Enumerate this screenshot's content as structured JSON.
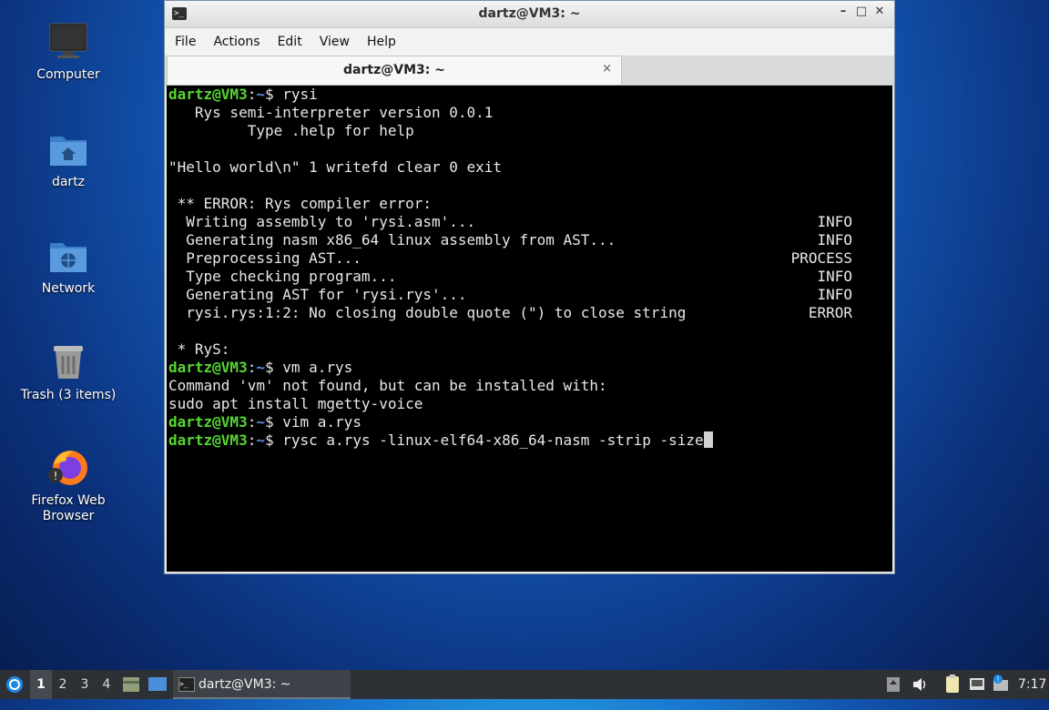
{
  "desktop": {
    "icons": [
      {
        "label": "Computer",
        "icon": "monitor-icon"
      },
      {
        "label": "dartz",
        "icon": "home-folder-icon"
      },
      {
        "label": "Network",
        "icon": "network-folder-icon"
      },
      {
        "label": "Trash (3 items)",
        "icon": "trash-icon"
      },
      {
        "label": "Firefox Web Browser",
        "icon": "firefox-icon"
      }
    ]
  },
  "window": {
    "title": "dartz@VM3: ~",
    "controls": {
      "minimize": "–",
      "maximize": "□",
      "close": "✕"
    },
    "menu": [
      "File",
      "Actions",
      "Edit",
      "View",
      "Help"
    ],
    "tab": {
      "title": "dartz@VM3: ~",
      "close": "×"
    }
  },
  "terminal": {
    "lines": [
      {
        "type": "prompt",
        "user": "dartz@VM3",
        "path": "~",
        "cmd": "rysi"
      },
      {
        "type": "text",
        "text": "   Rys semi-interpreter version 0.0.1"
      },
      {
        "type": "text",
        "text": "         Type .help for help"
      },
      {
        "type": "text",
        "text": ""
      },
      {
        "type": "text",
        "text": "\"Hello world\\n\" 1 writefd clear 0 exit"
      },
      {
        "type": "text",
        "text": ""
      },
      {
        "type": "text",
        "text": " ** ERROR: Rys compiler error:"
      },
      {
        "type": "status",
        "text": "  Writing assembly to 'rysi.asm'...",
        "status": "INFO"
      },
      {
        "type": "status",
        "text": "  Generating nasm x86_64 linux assembly from AST...",
        "status": "INFO"
      },
      {
        "type": "status",
        "text": "  Preprocessing AST...",
        "status": "PROCESS"
      },
      {
        "type": "status",
        "text": "  Type checking program...",
        "status": "INFO"
      },
      {
        "type": "status",
        "text": "  Generating AST for 'rysi.rys'...",
        "status": "INFO"
      },
      {
        "type": "status",
        "text": "  rysi.rys:1:2: No closing double quote (\") to close string",
        "status": "ERROR"
      },
      {
        "type": "text",
        "text": ""
      },
      {
        "type": "text",
        "text": " * RyS:"
      },
      {
        "type": "prompt",
        "user": "dartz@VM3",
        "path": "~",
        "cmd": "vm a.rys"
      },
      {
        "type": "text",
        "text": "Command 'vm' not found, but can be installed with:"
      },
      {
        "type": "text",
        "text": "sudo apt install mgetty-voice"
      },
      {
        "type": "prompt",
        "user": "dartz@VM3",
        "path": "~",
        "cmd": "vim a.rys"
      },
      {
        "type": "prompt",
        "user": "dartz@VM3",
        "path": "~",
        "cmd": "rysc a.rys -linux-elf64-x86_64-nasm -strip -size",
        "cursor": true
      }
    ]
  },
  "taskbar": {
    "workspaces": [
      "1",
      "2",
      "3",
      "4"
    ],
    "active_workspace": "1",
    "task": "dartz@VM3: ~",
    "clock": "7:17"
  }
}
